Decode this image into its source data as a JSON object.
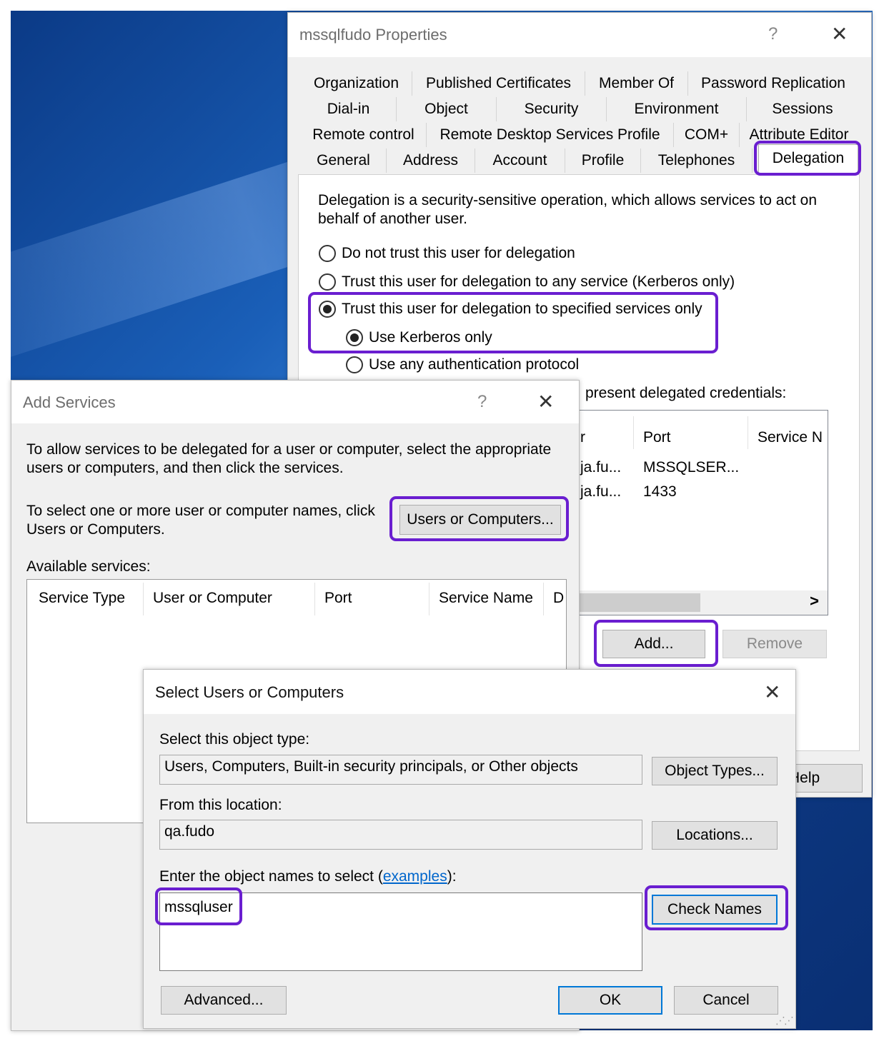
{
  "properties_dialog": {
    "title": "mssqlfudo Properties",
    "help_glyph": "?",
    "close_glyph": "✕",
    "tabs_row1": [
      "Organization",
      "Published Certificates",
      "Member Of",
      "Password Replication"
    ],
    "tabs_row2": [
      "Dial-in",
      "Object",
      "Security",
      "Environment",
      "Sessions"
    ],
    "tabs_row3": [
      "Remote control",
      "Remote Desktop Services Profile",
      "COM+",
      "Attribute Editor"
    ],
    "tabs_row4": [
      "General",
      "Address",
      "Account",
      "Profile",
      "Telephones",
      "Delegation"
    ],
    "description_line1": "Delegation is a security-sensitive operation, which allows services to act on",
    "description_line2": "behalf of another user.",
    "radio_no_trust": "Do not trust this user for delegation",
    "radio_any_service": "Trust this user for delegation to any service (Kerberos only)",
    "radio_specified": "Trust this user for delegation to specified services only",
    "radio_kerberos_only": "Use Kerberos only",
    "radio_any_protocol": "Use any authentication protocol",
    "credentials_text": "present delegated credentials:",
    "list_columns": [
      "r",
      "Port",
      "Service N"
    ],
    "list_rows": [
      {
        "user": "ja.fu...",
        "port": "MSSQLSER..."
      },
      {
        "user": "ja.fu...",
        "port": "1433"
      }
    ],
    "scroll_right": ">",
    "add_button": "Add...",
    "remove_button": "Remove",
    "help_button": "Help"
  },
  "add_services_dialog": {
    "title": "Add Services",
    "help_glyph": "?",
    "close_glyph": "✕",
    "intro_line1": "To allow services to be delegated for a user or computer, select the appropriate",
    "intro_line2": "users or computers, and then click the services.",
    "select_line1": "To select one or more user or computer names, click",
    "select_line2": "Users or Computers.",
    "users_computers_button": "Users or Computers...",
    "available_label": "Available services:",
    "columns": [
      "Service Type",
      "User or Computer",
      "Port",
      "Service Name",
      "D"
    ]
  },
  "select_dialog": {
    "title": "Select Users or Computers",
    "close_glyph": "✕",
    "object_type_label": "Select this object type:",
    "object_type_value": "Users, Computers, Built-in security principals, or Other objects",
    "object_types_button": "Object Types...",
    "location_label": "From this location:",
    "location_value": "qa.fudo",
    "locations_button": "Locations...",
    "enter_label_prefix": "Enter the object names to select (",
    "enter_label_link": "examples",
    "enter_label_suffix": "):",
    "names_value": "mssqluser",
    "check_names_button": "Check Names",
    "advanced_button": "Advanced...",
    "ok_button": "OK",
    "cancel_button": "Cancel"
  },
  "colors": {
    "highlight": "#6a1ed0",
    "link": "#0066cc",
    "default_button_border": "#0078d7"
  }
}
